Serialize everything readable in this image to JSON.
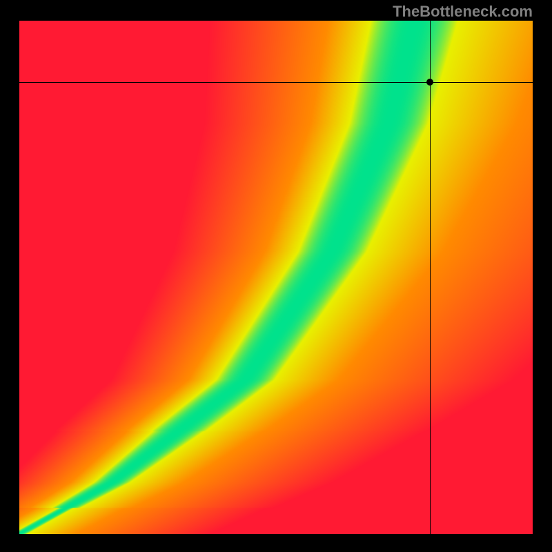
{
  "watermark": "TheBottleneck.com",
  "chart_data": {
    "type": "heatmap",
    "title": "",
    "xlabel": "",
    "ylabel": "",
    "xlim": [
      0,
      100
    ],
    "ylim": [
      0,
      100
    ],
    "crosshair": {
      "x": 80,
      "y": 88
    },
    "gradient_band": {
      "description": "Diagonal curved green band from bottom-left to upper-center representing optimal balance, surrounded by yellow transition zones, with red on far sides indicating bottleneck",
      "path_points": [
        {
          "x": 0,
          "y": 0
        },
        {
          "x": 20,
          "y": 10
        },
        {
          "x": 40,
          "y": 28
        },
        {
          "x": 55,
          "y": 50
        },
        {
          "x": 65,
          "y": 70
        },
        {
          "x": 72,
          "y": 90
        },
        {
          "x": 76,
          "y": 100
        }
      ]
    },
    "colors": {
      "optimal": "#00e28c",
      "good": "#e8f000",
      "warning": "#ff8a00",
      "bottleneck": "#ff1a33"
    }
  }
}
